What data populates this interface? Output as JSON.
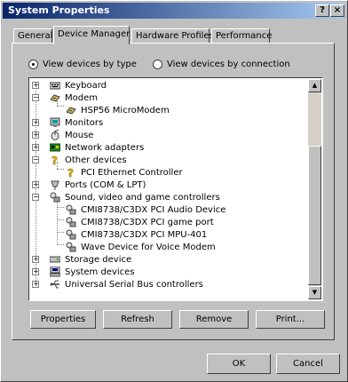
{
  "window": {
    "title": "System Properties",
    "help": "?",
    "close": "×"
  },
  "tabs": [
    "General",
    "Device Manager",
    "Hardware Profiles",
    "Performance"
  ],
  "view": {
    "by_type": "View devices by type",
    "by_connection": "View devices by connection"
  },
  "tree": {
    "items": [
      {
        "label": "Keyboard",
        "icon": "keyboard-icon",
        "expander": "+"
      },
      {
        "label": "Modem",
        "icon": "modem-icon",
        "expander": "−"
      },
      {
        "label": "HSP56 MicroModem",
        "icon": "modem-icon"
      },
      {
        "label": "Monitors",
        "icon": "monitor-icon",
        "expander": "+"
      },
      {
        "label": "Mouse",
        "icon": "mouse-icon",
        "expander": "+"
      },
      {
        "label": "Network adapters",
        "icon": "network-adapter-icon",
        "expander": "+"
      },
      {
        "label": "Other devices",
        "icon": "question-icon",
        "expander": "−"
      },
      {
        "label": "PCI Ethernet Controller",
        "icon": "question-icon"
      },
      {
        "label": "Ports (COM & LPT)",
        "icon": "port-icon",
        "expander": "+"
      },
      {
        "label": "Sound, video and game controllers",
        "icon": "sound-icon",
        "expander": "−"
      },
      {
        "label": "CMI8738/C3DX PCI Audio Device",
        "icon": "sound-icon"
      },
      {
        "label": "CMI8738/C3DX PCI game port",
        "icon": "sound-icon"
      },
      {
        "label": "CMI8738/C3DX PCI MPU-401",
        "icon": "sound-icon"
      },
      {
        "label": "Wave Device for Voice Modem",
        "icon": "sound-icon"
      },
      {
        "label": "Storage device",
        "icon": "storage-icon",
        "expander": "+"
      },
      {
        "label": "System devices",
        "icon": "computer-icon",
        "expander": "+"
      },
      {
        "label": "Universal Serial Bus controllers",
        "icon": "usb-icon",
        "expander": "+"
      }
    ],
    "scroll_up": "▲",
    "scroll_down": "▼"
  },
  "buttons": {
    "properties": "Properties",
    "refresh": "Refresh",
    "remove": "Remove",
    "print": "Print...",
    "ok": "OK",
    "cancel": "Cancel"
  }
}
